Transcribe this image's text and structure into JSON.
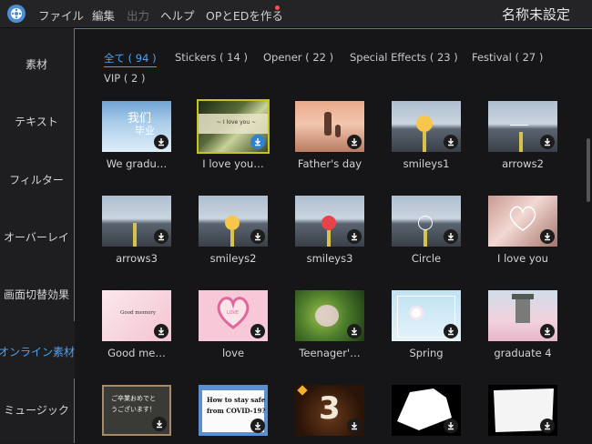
{
  "menu": {
    "file": "ファイル",
    "edit": "編集",
    "output": "出力",
    "help": "ヘルプ",
    "op_ed": "OPとEDを作る",
    "project_title": "名称未設定"
  },
  "sidebar": {
    "items": [
      {
        "label": "素材"
      },
      {
        "label": "テキスト"
      },
      {
        "label": "フィルター"
      },
      {
        "label": "オーバーレイ"
      },
      {
        "label": "画面切替効果"
      },
      {
        "label": "オンライン素材"
      },
      {
        "label": "ミュージック"
      }
    ]
  },
  "categories": [
    {
      "label": "全て ( 94 )"
    },
    {
      "label": "Stickers ( 14 )"
    },
    {
      "label": "Opener ( 22 )"
    },
    {
      "label": "Special Effects ( 23 )"
    },
    {
      "label": "Festival ( 27 )"
    },
    {
      "label": "VIP ( 2 )"
    }
  ],
  "items": [
    {
      "label": "We gradu…"
    },
    {
      "label": "I love you…"
    },
    {
      "label": "Father's day"
    },
    {
      "label": "smileys1"
    },
    {
      "label": "arrows2"
    },
    {
      "label": "arrows3"
    },
    {
      "label": "smileys2"
    },
    {
      "label": "smileys3"
    },
    {
      "label": "Circle"
    },
    {
      "label": "I love you"
    },
    {
      "label": "Good me…"
    },
    {
      "label": "love"
    },
    {
      "label": "Teenager'…"
    },
    {
      "label": "Spring"
    },
    {
      "label": "graduate 4"
    },
    {
      "label": ""
    },
    {
      "label": ""
    },
    {
      "label": ""
    },
    {
      "label": ""
    },
    {
      "label": ""
    }
  ],
  "thumb_text": {
    "good_memory": "Good memory",
    "love": "LOVE",
    "jp_line1": "ご卒業おめでと",
    "jp_line2": "うございます！",
    "covid_line1": "How to stay safe",
    "covid_line2": "from COVID-19?",
    "number3": "3"
  },
  "colors": {
    "accent": "#2f82d0",
    "active_text": "#4ea2f0",
    "selected_border": "#c8c41e"
  }
}
